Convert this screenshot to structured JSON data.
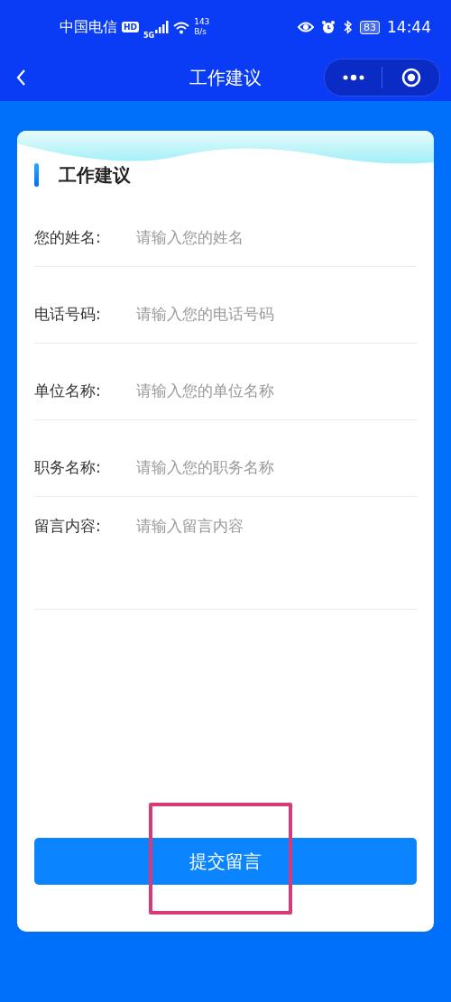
{
  "status_bar": {
    "carrier": "中国电信",
    "hd_badge": "HD",
    "network": "5G",
    "speed_value": "143",
    "speed_unit": "B/s",
    "battery": "83",
    "time": "14:44"
  },
  "nav_bar": {
    "title": "工作建议"
  },
  "form": {
    "title": "工作建议",
    "fields": [
      {
        "kind": "input",
        "label": "您的姓名:",
        "placeholder": "请输入您的姓名"
      },
      {
        "kind": "input",
        "label": "电话号码:",
        "placeholder": "请输入您的电话号码"
      },
      {
        "kind": "input",
        "label": "单位名称:",
        "placeholder": "请输入您的单位名称"
      },
      {
        "kind": "input",
        "label": "职务名称:",
        "placeholder": "请输入您的职务名称"
      },
      {
        "kind": "textarea",
        "label": "留言内容:",
        "placeholder": "请输入留言内容"
      }
    ],
    "submit_button": {
      "label": "提交留言",
      "highlighted": true
    }
  }
}
